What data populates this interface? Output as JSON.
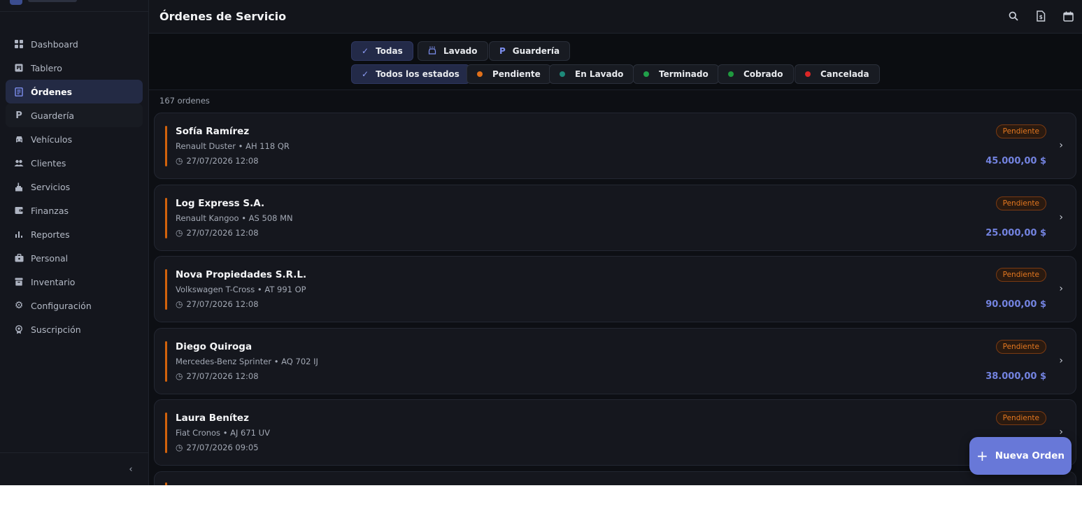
{
  "header": {
    "title": "Órdenes de Servicio"
  },
  "sidebar": {
    "items": [
      {
        "label": "Dashboard",
        "icon": "grid-icon"
      },
      {
        "label": "Tablero",
        "icon": "board-icon"
      },
      {
        "label": "Órdenes",
        "icon": "receipt-icon",
        "active": true
      },
      {
        "label": "Guardería",
        "icon": "parking-icon"
      },
      {
        "label": "Vehículos",
        "icon": "car-icon"
      },
      {
        "label": "Clientes",
        "icon": "users-icon"
      },
      {
        "label": "Servicios",
        "icon": "wash-icon"
      },
      {
        "label": "Finanzas",
        "icon": "wallet-icon"
      },
      {
        "label": "Reportes",
        "icon": "chart-icon"
      },
      {
        "label": "Personal",
        "icon": "briefcase-icon"
      },
      {
        "label": "Inventario",
        "icon": "archive-icon"
      },
      {
        "label": "Configuración",
        "icon": "gear-icon"
      },
      {
        "label": "Suscripción",
        "icon": "badge-icon"
      }
    ]
  },
  "filters": {
    "types": [
      {
        "label": "Todas",
        "active": true
      },
      {
        "label": "Lavado",
        "active": false
      },
      {
        "label": "Guardería",
        "active": false
      }
    ],
    "statuses": [
      {
        "label": "Todos los estados",
        "active": true
      },
      {
        "label": "Pendiente",
        "color": "#e0701a"
      },
      {
        "label": "En Lavado",
        "color": "#1d8a7a"
      },
      {
        "label": "Terminado",
        "color": "#21a04a"
      },
      {
        "label": "Cobrado",
        "color": "#1f9a3e"
      },
      {
        "label": "Cancelada",
        "color": "#dc2626"
      }
    ]
  },
  "list": {
    "count_text": "167 ordenes",
    "orders": [
      {
        "name": "Sofía Ramírez",
        "vehicle": "Renault Duster • AH 118 QR",
        "date": "27/07/2026 12:08",
        "status": "Pendiente",
        "amount": "45.000,00 $"
      },
      {
        "name": "Log Express S.A.",
        "vehicle": "Renault Kangoo • AS 508 MN",
        "date": "27/07/2026 12:08",
        "status": "Pendiente",
        "amount": "25.000,00 $"
      },
      {
        "name": "Nova Propiedades S.R.L.",
        "vehicle": "Volkswagen T-Cross • AT 991 OP",
        "date": "27/07/2026 12:08",
        "status": "Pendiente",
        "amount": "90.000,00 $"
      },
      {
        "name": "Diego Quiroga",
        "vehicle": "Mercedes-Benz Sprinter • AQ 702 IJ",
        "date": "27/07/2026 12:08",
        "status": "Pendiente",
        "amount": "38.000,00 $"
      },
      {
        "name": "Laura Benítez",
        "vehicle": "Fiat Cronos • AJ 671 UV",
        "date": "27/07/2026 09:05",
        "status": "Pendiente",
        "amount": ""
      }
    ]
  },
  "fab": {
    "label": "Nueva Orden"
  }
}
